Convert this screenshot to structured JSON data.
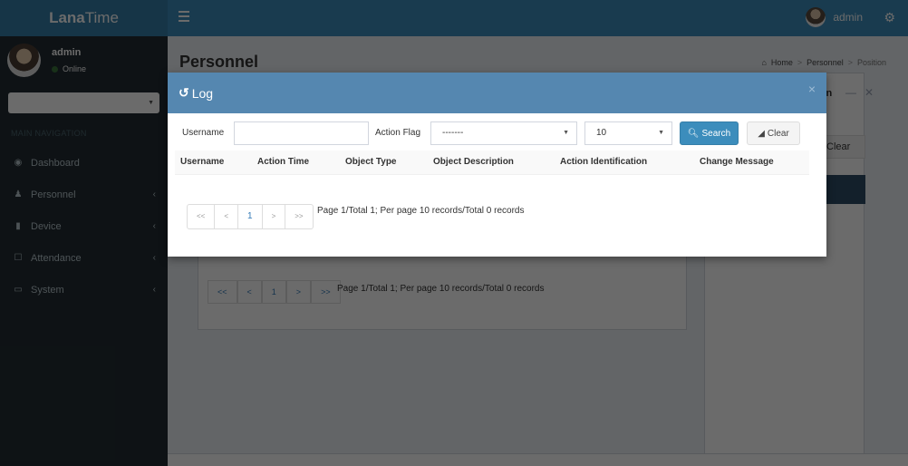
{
  "app": {
    "logo_bold": "Lana",
    "logo_light": "Time"
  },
  "topbar": {
    "user": "admin",
    "menu_icon": "bars-icon",
    "settings_icon": "gears-icon"
  },
  "sidebar": {
    "user_name": "admin",
    "user_status": "Online",
    "nav_header": "MAIN NAVIGATION",
    "items": [
      {
        "label": "Dashboard",
        "icon": "dashboard-icon",
        "has_children": false
      },
      {
        "label": "Personnel",
        "icon": "users-icon",
        "has_children": true
      },
      {
        "label": "Device",
        "icon": "device-icon",
        "has_children": true
      },
      {
        "label": "Attendance",
        "icon": "attendance-icon",
        "has_children": true
      },
      {
        "label": "System",
        "icon": "laptop-icon",
        "has_children": true
      }
    ]
  },
  "page": {
    "title": "Personnel",
    "breadcrumb": [
      "Home",
      "Personnel",
      "Position"
    ],
    "background_panel_title": "tion",
    "background_clear": "Clear",
    "background_pager": [
      "<<",
      "<",
      "1",
      ">",
      ">>"
    ],
    "background_pager_text": "Page 1/Total 1; Per page 10 records/Total 0 records"
  },
  "modal": {
    "title": "Log",
    "title_icon": "history-icon",
    "close_label": "×",
    "filters": {
      "username_label": "Username",
      "username_value": "",
      "action_flag_label": "Action Flag",
      "action_flag_value": "-------",
      "page_size_value": "10",
      "search_label": "Search",
      "clear_label": "Clear"
    },
    "table": {
      "columns": [
        "Username",
        "Action Time",
        "Object Type",
        "Object Description",
        "Action Identification",
        "Change Message"
      ],
      "rows": []
    },
    "pager": {
      "buttons": [
        "<<",
        "<",
        "1",
        ">",
        ">>"
      ],
      "summary": "Page 1/Total 1; Per page 10 records/Total 0 records"
    }
  }
}
